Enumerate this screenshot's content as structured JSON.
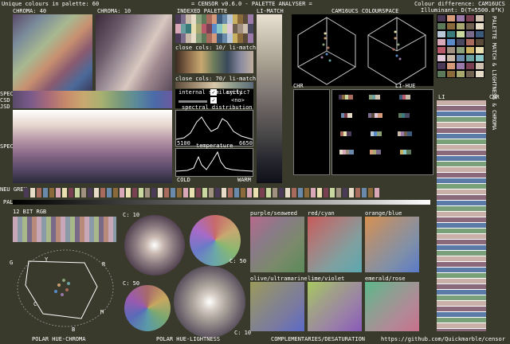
{
  "header": {
    "unique_colours": "Unique colours in palette: 60",
    "app_title": "= CENSOR v0.6.0 - PALETTE ANALYSER =",
    "colour_difference": "Colour difference: CAM16UCS",
    "illuminant": "Illuminant: D(T=5500.0°K)"
  },
  "top_labels": {
    "chroma40": "CHROMA: 40",
    "chroma10": "CHROMA: 10",
    "indexed_palette": "INDEXED PALETTE",
    "li_match": "LI-MATCH",
    "colourspace": "CAM16UCS COLOURSPACE"
  },
  "palette_panel": {
    "close_cols_10": "close cols: 10/ li-match",
    "close_cols_70": "close cols: 70/ li-match",
    "internal_similarity": "internal similarity",
    "cyclic": "cyclic?",
    "cyclic_value": "<no>",
    "spectral_distribution": "spectral distribution",
    "spec_min": "5100",
    "spec_max": "6650",
    "temperature": "temperature",
    "cold": "COLD",
    "warm": "WARM"
  },
  "side_labels": {
    "spec": "SPEC",
    "csd": "CSD",
    "jsd": "JSD",
    "spec_ed": "SPEC EDS",
    "neu_grey": "NEU GREY",
    "pal": "PAL"
  },
  "chr_label": "CHR",
  "li_hue_label": "LI-HUE",
  "right_labels": {
    "li": "LI",
    "chr": "CHR",
    "vertical_text": "PALETTE MATCH & LIGHTNESS & CHROMA"
  },
  "bottom": {
    "bit12": "12 BIT RGB",
    "c10_a": "C: 10",
    "c50_a": "C: 50",
    "c50_b": "C: 50",
    "c10_b": "C: 10",
    "purple_seaweed": "purple/seaweed",
    "red_cyan": "red/cyan",
    "orange_blue": "orange/blue",
    "olive_ultramarine": "olive/ultramarine",
    "lime_violet": "lime/violet",
    "emerald_rose": "emerald/rose",
    "polar_hue_chroma": "POLAR HUE-CHROMA",
    "polar_hue_lightness": "POLAR HUE-LIGHTNESS",
    "complementaries": "COMPLEMENTARIES/DESATURATION",
    "url": "https://github.com/Quickmarble/censor"
  },
  "polar_letters": {
    "g": "G",
    "y": "Y",
    "r": "R",
    "c": "C",
    "b": "B",
    "m": "M"
  },
  "colors": {
    "frame": "#3a3a2c",
    "panel": "#000000",
    "text": "#ffffff"
  },
  "palette_swatches": [
    "#4a3a58",
    "#7a6b8c",
    "#c9b9a8",
    "#e6dcc8",
    "#8aa07a",
    "#5c7a5a",
    "#a86a5c",
    "#d49a7a",
    "#3c5a7c",
    "#6a8aac",
    "#b8c8d8",
    "#c8b060",
    "#8a6a3a",
    "#5a4a3a",
    "#9a7aa8",
    "#d8a8b8",
    "#6aa0a0",
    "#3a7a7a",
    "#e8e0b0",
    "#a8a870",
    "#b85a6a",
    "#784050",
    "#5a8ac8",
    "#8ac8c8",
    "#c8d8a0",
    "#e0c8d8",
    "#706050",
    "#a09080",
    "#d0c0b0",
    "#484860"
  ]
}
